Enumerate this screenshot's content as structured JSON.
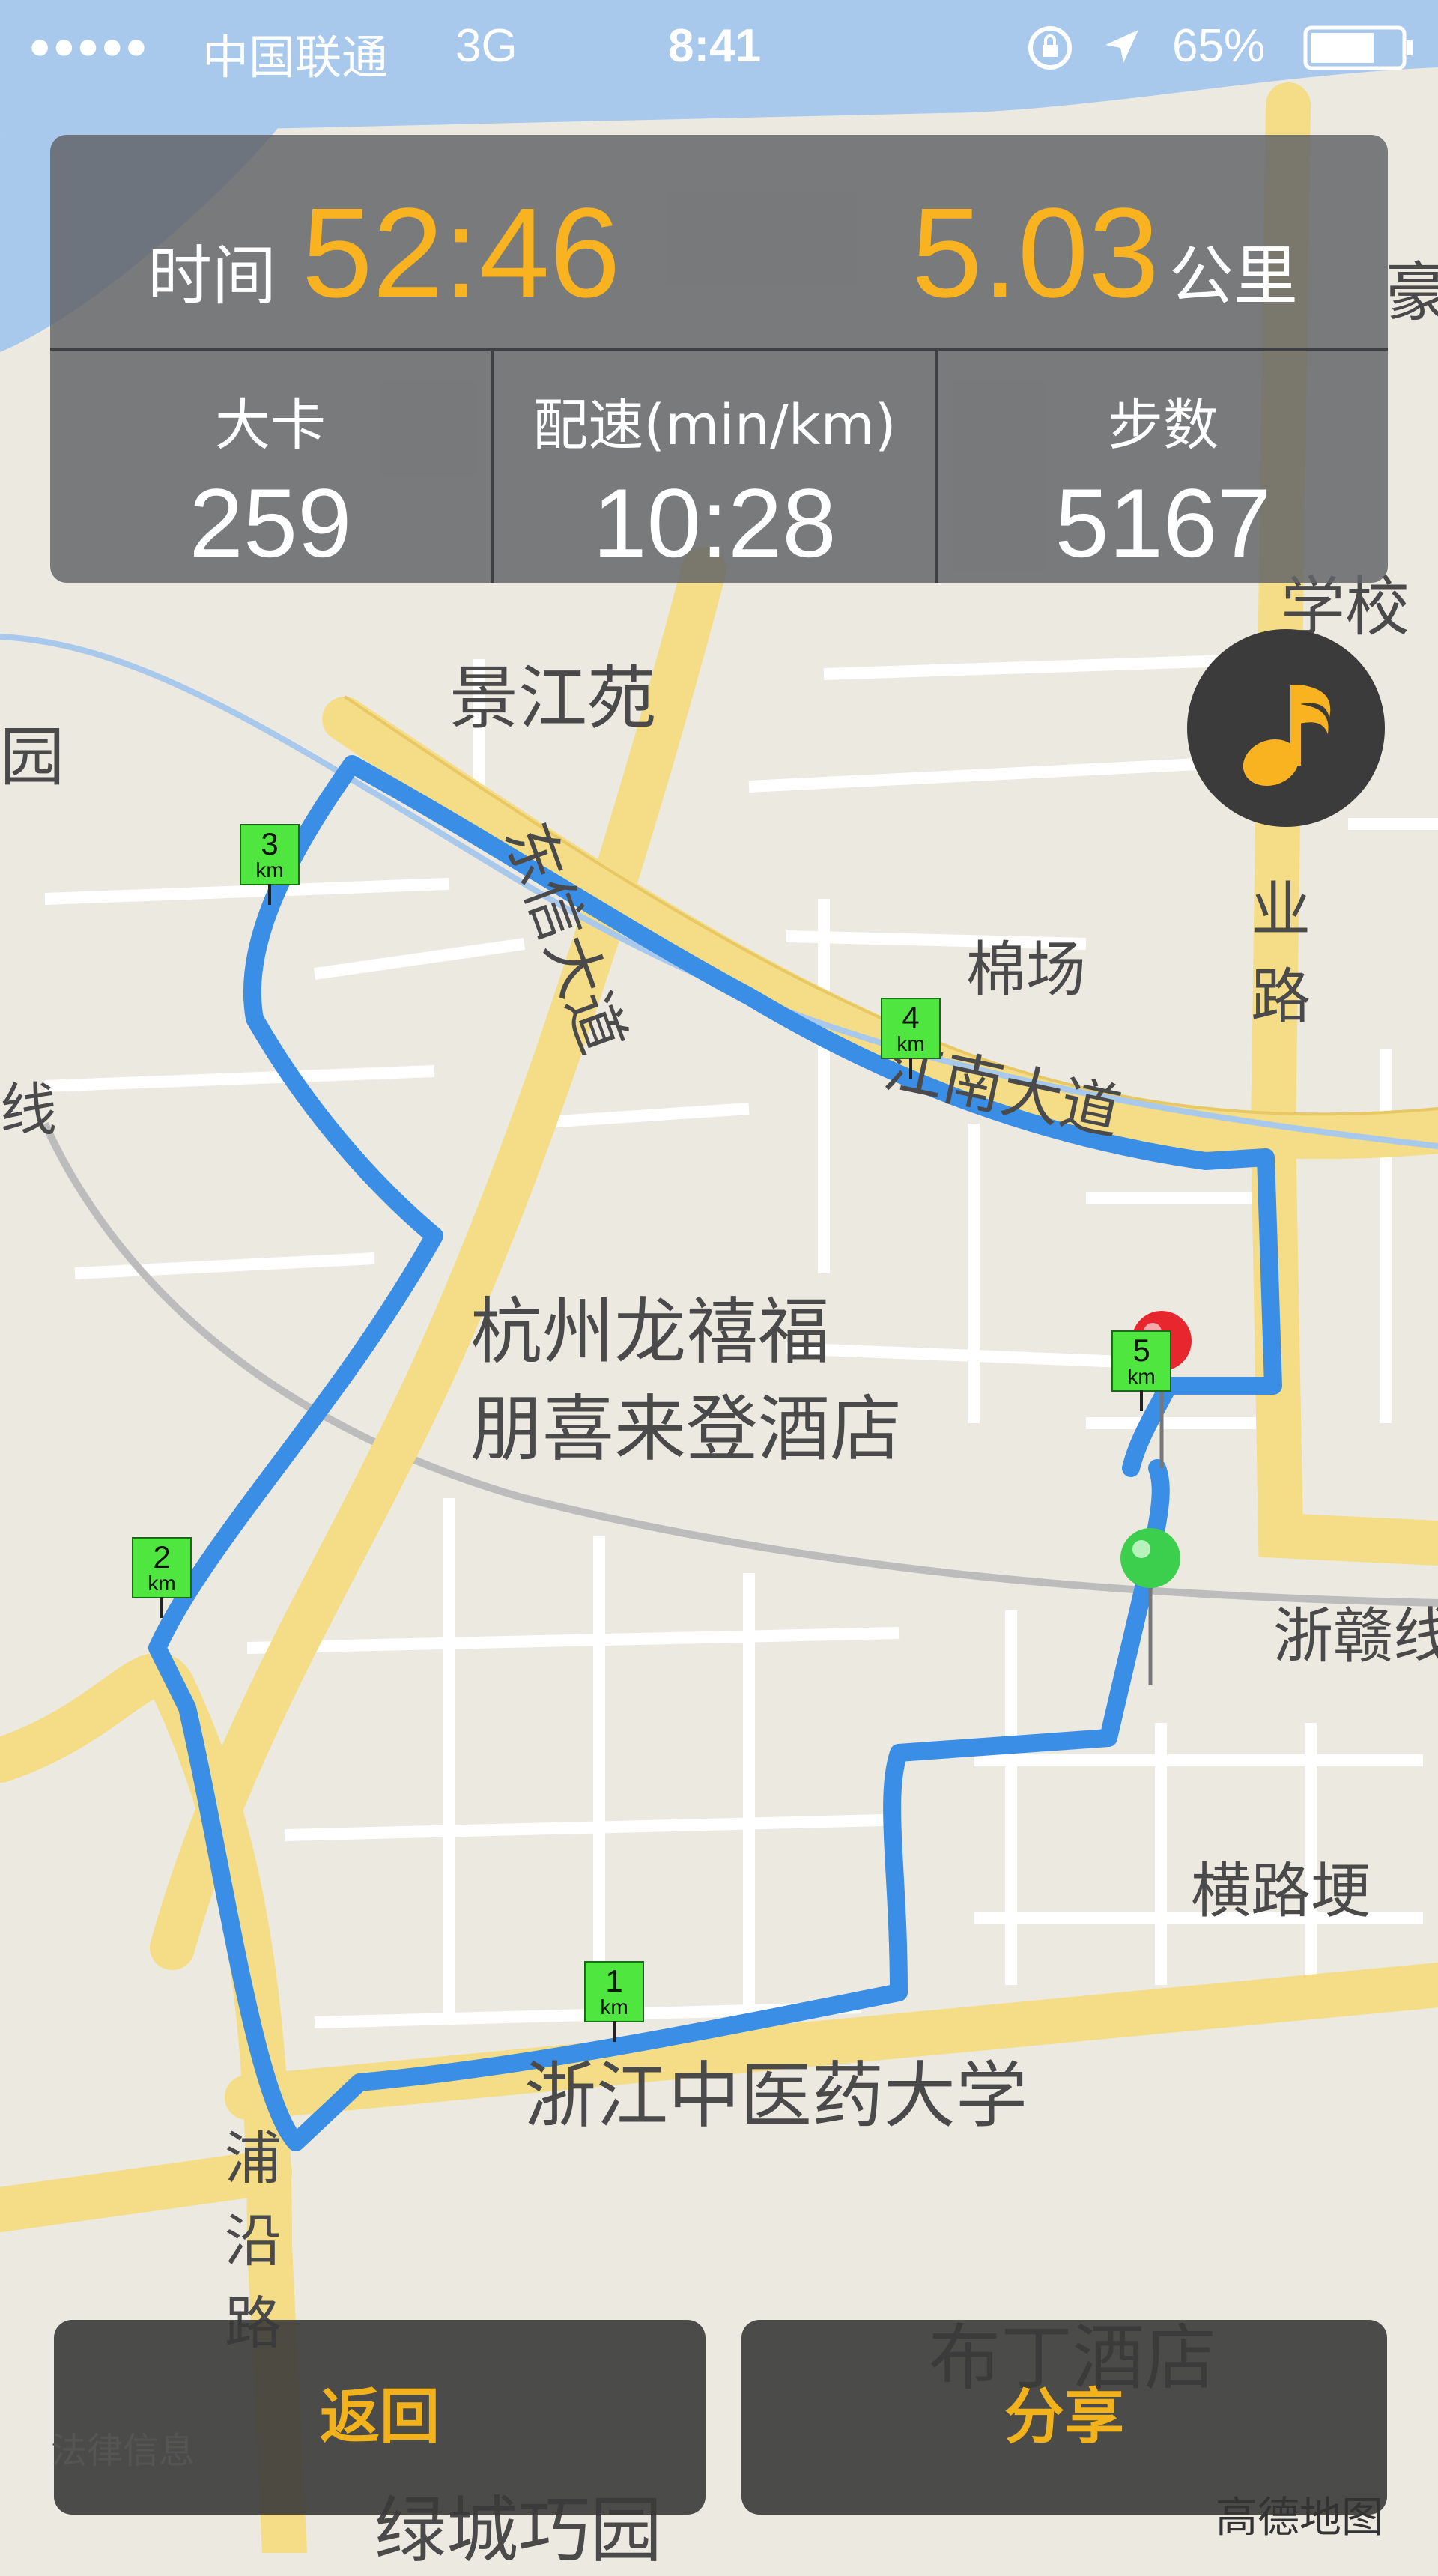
{
  "status_bar": {
    "signal": "●●●●●",
    "carrier": "中国联通",
    "network": "3G",
    "time": "8:41",
    "battery": "65%"
  },
  "stats": {
    "time_label": "时间",
    "time_value": "52:46",
    "distance_value": "5.03",
    "distance_unit": "公里",
    "calories_label": "大卡",
    "calories_value": "259",
    "pace_label": "配速(min/km)",
    "pace_value": "10:28",
    "steps_label": "步数",
    "steps_value": "5167"
  },
  "map": {
    "labels": {
      "jingjiangyuan": "景江苑",
      "dongxin": "东信大道",
      "mianchang": "棉场",
      "jiangnan": "江南大道",
      "ye_lu": "业路",
      "hotel1": "杭州龙禧福",
      "hotel2": "朋喜来登酒店",
      "zhegan": "浙赣线",
      "henglugeng": "横路埂",
      "university": "浙江中医药大学",
      "puyan": "浦沿路",
      "buding": "布丁酒店",
      "lvcheng": "绿城巧园",
      "hao": "豪",
      "xiao": "学校",
      "yuan": "园",
      "xian": "线"
    },
    "km_markers": [
      {
        "n": "1",
        "unit": "km"
      },
      {
        "n": "2",
        "unit": "km"
      },
      {
        "n": "3",
        "unit": "km"
      },
      {
        "n": "4",
        "unit": "km"
      },
      {
        "n": "5",
        "unit": "km"
      }
    ]
  },
  "buttons": {
    "back": "返回",
    "share": "分享"
  },
  "footer": {
    "legal": "法律信息",
    "provider": "高德地图"
  },
  "colors": {
    "accent": "#f9b220",
    "route": "#3a8ee6",
    "marker": "#4ee63f",
    "start_pin": "#3ccf4e",
    "end_pin": "#e8262e"
  }
}
